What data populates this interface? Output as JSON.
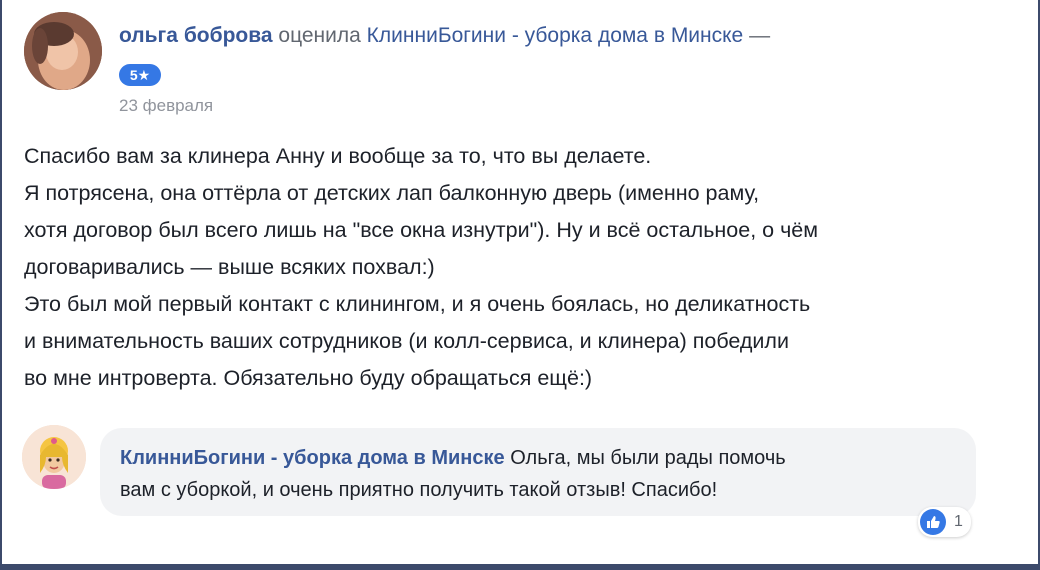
{
  "review": {
    "author": "ольга боброва",
    "verb": "оценила",
    "page_name": "КлинниБогини - уборка дома в Минске",
    "dash": "—",
    "rating": "5★",
    "date": "23 февраля",
    "lines": [
      "Спасибо вам за клинера Анну и вообще за то, что вы делаете.",
      "Я потрясена, она оттёрла от детских лап балконную дверь (именно раму,",
      "хотя договор был всего лишь на \"все окна изнутри\"). Ну и всё остальное, о чём",
      "договаривались — выше всяких похвал:)",
      "Это был мой первый контакт с клинингом, и я очень боялась, но деликатность",
      "и внимательность ваших сотрудников (и колл-сервиса, и клинера) победили",
      "во мне интроверта. Обязательно буду обращаться ещё:)"
    ]
  },
  "reply": {
    "author": "КлинниБогини - уборка дома в Минске",
    "text_line1": "Ольга, мы были рады помочь",
    "text_line2": "вам с уборкой, и очень приятно получить такой отзыв! Спасибо!",
    "like_count": "1"
  },
  "colors": {
    "link_blue": "#385898",
    "badge_blue": "#3578e5",
    "bubble_bg": "#f2f3f5",
    "frame": "#3c4a6b"
  }
}
